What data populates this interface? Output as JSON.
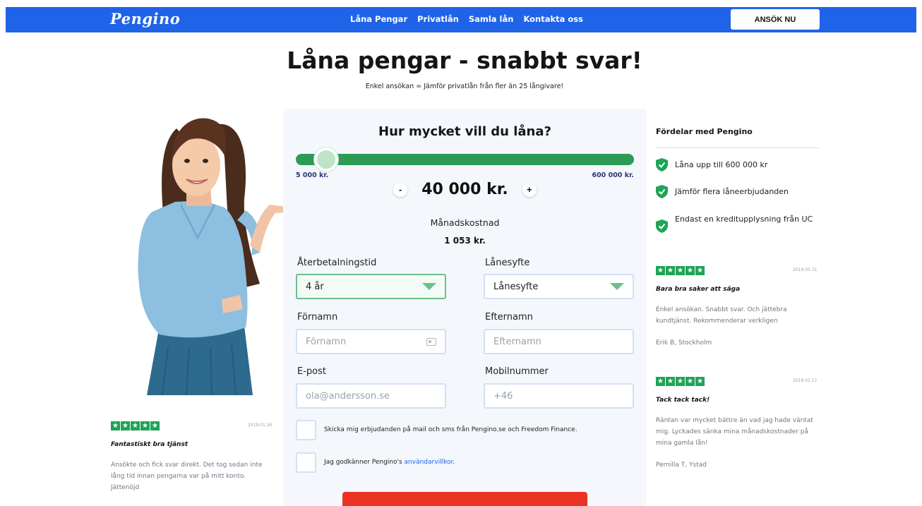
{
  "header": {
    "logo": "Pengino",
    "nav": [
      "Låna Pengar",
      "Privatlån",
      "Samla lån",
      "Kontakta oss"
    ],
    "apply_button": "ANSÖK NU"
  },
  "hero": {
    "title": "Låna pengar - snabbt svar!",
    "subtitle": "Enkel ansökan = Jämför privatlån från fler än 25 långivare!"
  },
  "calculator": {
    "question": "Hur mycket vill du låna?",
    "slider_min": "5 000 kr.",
    "slider_max": "600 000 kr.",
    "amount": "40 000 kr.",
    "decrement": "-",
    "increment": "+",
    "monthly_label": "Månadskostnad",
    "monthly_value": "1 053 kr."
  },
  "form": {
    "term_label": "Återbetalningstid",
    "term_value": "4 år",
    "purpose_label": "Lånesyfte",
    "purpose_value": "Lånesyfte",
    "firstname_label": "Förnamn",
    "firstname_placeholder": "Förnamn",
    "lastname_label": "Efternamn",
    "lastname_placeholder": "Efternamn",
    "email_label": "E-post",
    "email_placeholder": "ola@andersson.se",
    "phone_label": "Mobilnummer",
    "phone_placeholder": "+46",
    "consent_offers": "Skicka mig erbjudanden på mail och sms från Pengino.se och Freedom Finance.",
    "consent_terms_prefix": "Jag godkänner Pengino's ",
    "consent_terms_link": "användarvillkor",
    "consent_terms_suffix": "."
  },
  "sidebar": {
    "title": "Fördelar med Pengino",
    "benefits": [
      "Låna upp till 600 000 kr",
      "Jämför flera låneerbjudanden",
      "Endast en kreditupplysning från UC"
    ]
  },
  "reviews": [
    {
      "rating": 5,
      "date": "2019.01.26",
      "title": "Fantastiskt bra tjänst",
      "body": "Ansökte och fick svar direkt. Det tog sedan inte lång tid innan pengarna var på mitt konto. Jättenöjd"
    },
    {
      "rating": 5,
      "date": "2019.05.31",
      "title": "Bara bra saker att säga",
      "body": "Enkel ansökan. Snabbt svar. Och jättebra kundtjänst. Rekommenderar verkligen",
      "author": "Erik B, Stockholm"
    },
    {
      "rating": 5,
      "date": "2018.05.17",
      "title": "Tack tack tack!",
      "body": "Räntan var mycket bättre än vad jag hade väntat mig. Lyckades sänka mina månadskostnader på mina gamla lån!",
      "author": "Pernilla T, Ystad"
    }
  ],
  "colors": {
    "brand_blue": "#1f63e8",
    "success_green": "#2d9a55",
    "star_green": "#1ea357",
    "cta_red": "#ea3323"
  },
  "icons": {
    "benefit": "shield-check-icon",
    "star": "star-icon",
    "contact": "contact-card-icon",
    "dropdown": "chevron-down-icon"
  }
}
